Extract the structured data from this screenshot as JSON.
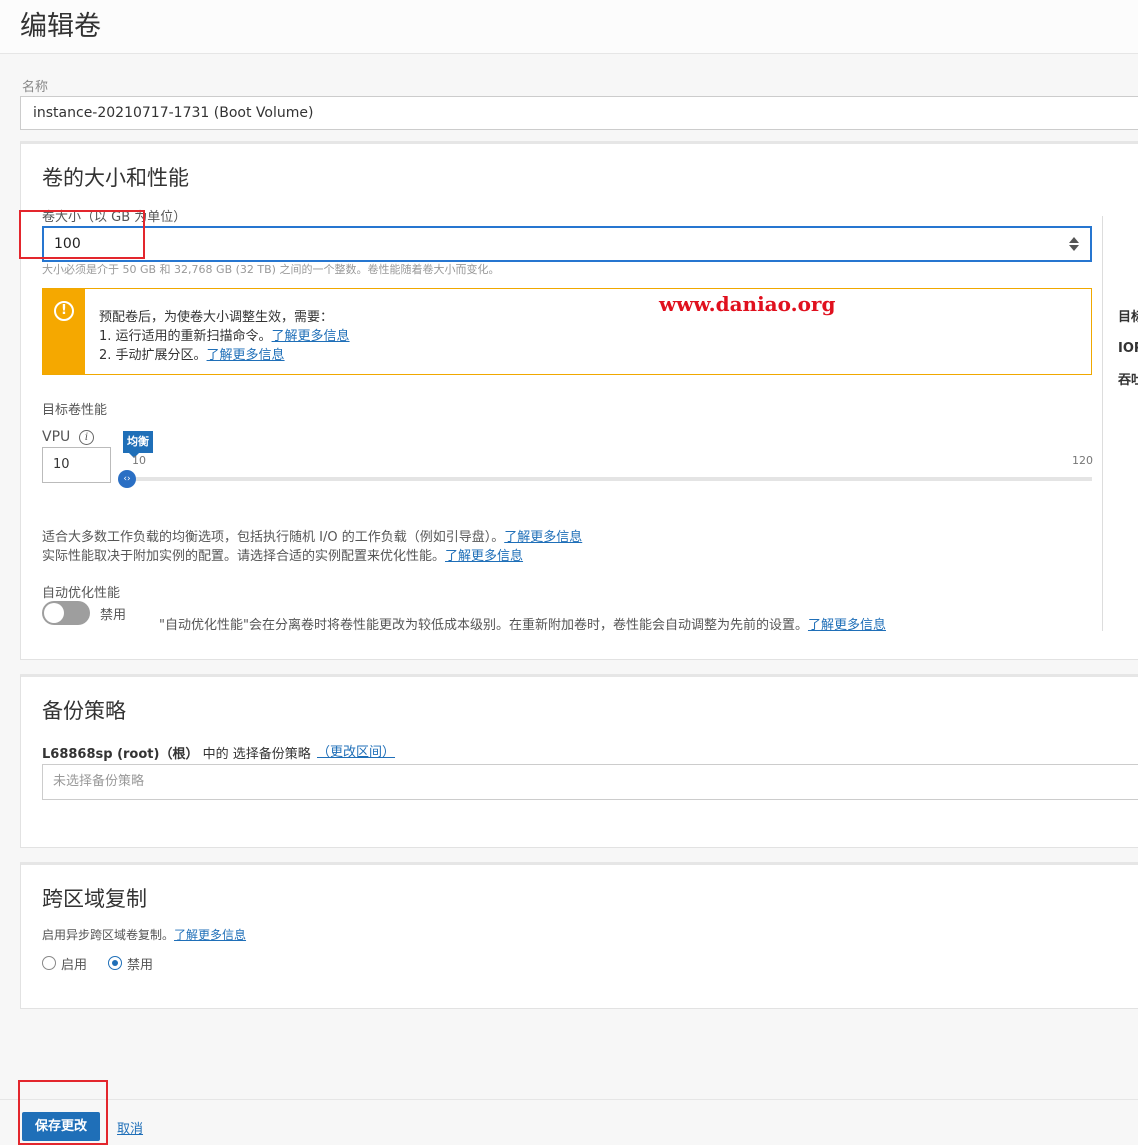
{
  "page": {
    "title": "编辑卷"
  },
  "name_field": {
    "label": "名称",
    "value": "instance-20210717-1731 (Boot Volume)"
  },
  "size_perf": {
    "title": "卷的大小和性能",
    "size_label": "卷大小（以 GB 为单位）",
    "size_value": "100",
    "size_hint": "大小必须是介于 50 GB 和 32,768 GB (32 TB) 之间的一个整数。卷性能随着卷大小而变化。",
    "callout": {
      "line1": "预配卷后，为使卷大小调整生效，需要：",
      "line2": "1. 运行适用的重新扫描命令。",
      "line2_link": "了解更多信息",
      "line3": "2. 手动扩展分区。",
      "line3_link": "了解更多信息"
    },
    "watermark": "www.daniao.org",
    "target_perf_label": "目标卷性能",
    "vpu_label": "VPU",
    "vpu_value": "10",
    "slider": {
      "badge": "均衡",
      "min_label": "10",
      "max_label": "120",
      "value": 10
    },
    "desc_line1": "适合大多数工作负载的均衡选项，包括执行随机 I/O 的工作负载（例如引导盘）。",
    "desc_line1_link": "了解更多信息",
    "desc_line2": "实际性能取决于附加实例的配置。请选择合适的实例配置来优化性能。",
    "desc_line2_link": "了解更多信息",
    "auto_tune_label": "自动优化性能",
    "auto_tune_state": "禁用",
    "auto_tune_desc": "\"自动优化性能\"会在分离卷时将卷性能更改为较低成本级别。在重新附加卷时，卷性能会自动调整为先前的设置。",
    "auto_tune_link": "了解更多信息",
    "right_panel": [
      "目标",
      "IOP",
      "吞吐"
    ]
  },
  "backup": {
    "title": "备份策略",
    "compartment_bold": "L68868sp (root)（根）",
    "compartment_text": "中的 选择备份策略",
    "change_link": "（更改区间）",
    "placeholder": "未选择备份策略"
  },
  "replication": {
    "title": "跨区域复制",
    "desc": "启用异步跨区域卷复制。",
    "desc_link": "了解更多信息",
    "options": [
      "启用",
      "禁用"
    ],
    "selected": "禁用"
  },
  "footer": {
    "save_label": "保存更改",
    "cancel_label": "取消"
  },
  "colors": {
    "primary": "#1f6fb8",
    "warning": "#f5a800",
    "highlight": "#e3262d"
  }
}
